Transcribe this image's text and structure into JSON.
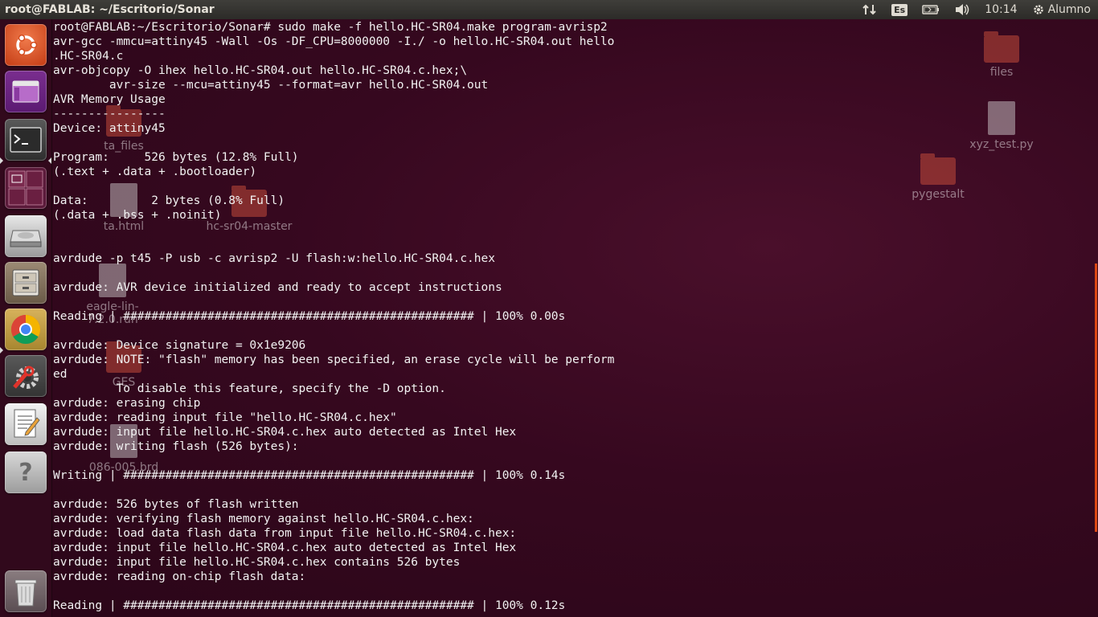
{
  "top_panel": {
    "window_title": "root@FABLAB: ~/Escritorio/Sonar",
    "keyboard_layout": "Es",
    "time": "10:14",
    "user": "Alumno"
  },
  "launcher": {
    "items": [
      {
        "name": "dash-home-icon"
      },
      {
        "name": "workspace-app-icon"
      },
      {
        "name": "terminal-icon"
      },
      {
        "name": "workspace-switcher-icon"
      },
      {
        "name": "disk-drive-icon"
      },
      {
        "name": "file-manager-icon"
      },
      {
        "name": "chrome-icon"
      },
      {
        "name": "system-settings-icon"
      },
      {
        "name": "text-editor-icon"
      },
      {
        "name": "help-icon"
      },
      {
        "name": "trash-icon"
      }
    ]
  },
  "desktop_icons": [
    {
      "label": "files",
      "kind": "folder"
    },
    {
      "label": "xyz_test.py",
      "kind": "doc"
    },
    {
      "label": "pygestalt",
      "kind": "folder"
    },
    {
      "label": "ta_files",
      "kind": "folder"
    },
    {
      "label": "ta.html",
      "kind": "doc"
    },
    {
      "label": "hc-sr04-master",
      "kind": "folder"
    },
    {
      "label": "eagle-lin-7.2.0.run",
      "kind": "doc"
    },
    {
      "label": "GES",
      "kind": "folder"
    },
    {
      "label": "086-005.brd",
      "kind": "doc"
    }
  ],
  "terminal": {
    "lines": [
      "root@FABLAB:~/Escritorio/Sonar# sudo make -f hello.HC-SR04.make program-avrisp2",
      "avr-gcc -mmcu=attiny45 -Wall -Os -DF_CPU=8000000 -I./ -o hello.HC-SR04.out hello",
      ".HC-SR04.c",
      "avr-objcopy -O ihex hello.HC-SR04.out hello.HC-SR04.c.hex;\\",
      "        avr-size --mcu=attiny45 --format=avr hello.HC-SR04.out",
      "AVR Memory Usage",
      "----------------",
      "Device: attiny45",
      "",
      "Program:     526 bytes (12.8% Full)",
      "(.text + .data + .bootloader)",
      "",
      "Data:         2 bytes (0.8% Full)",
      "(.data + .bss + .noinit)",
      "",
      "",
      "avrdude -p t45 -P usb -c avrisp2 -U flash:w:hello.HC-SR04.c.hex",
      "",
      "avrdude: AVR device initialized and ready to accept instructions",
      "",
      "Reading | ################################################## | 100% 0.00s",
      "",
      "avrdude: Device signature = 0x1e9206",
      "avrdude: NOTE: \"flash\" memory has been specified, an erase cycle will be perform",
      "ed",
      "         To disable this feature, specify the -D option.",
      "avrdude: erasing chip",
      "avrdude: reading input file \"hello.HC-SR04.c.hex\"",
      "avrdude: input file hello.HC-SR04.c.hex auto detected as Intel Hex",
      "avrdude: writing flash (526 bytes):",
      "",
      "Writing | ################################################## | 100% 0.14s",
      "",
      "avrdude: 526 bytes of flash written",
      "avrdude: verifying flash memory against hello.HC-SR04.c.hex:",
      "avrdude: load data flash data from input file hello.HC-SR04.c.hex:",
      "avrdude: input file hello.HC-SR04.c.hex auto detected as Intel Hex",
      "avrdude: input file hello.HC-SR04.c.hex contains 526 bytes",
      "avrdude: reading on-chip flash data:",
      "",
      "Reading | ################################################## | 100% 0.12s"
    ]
  }
}
